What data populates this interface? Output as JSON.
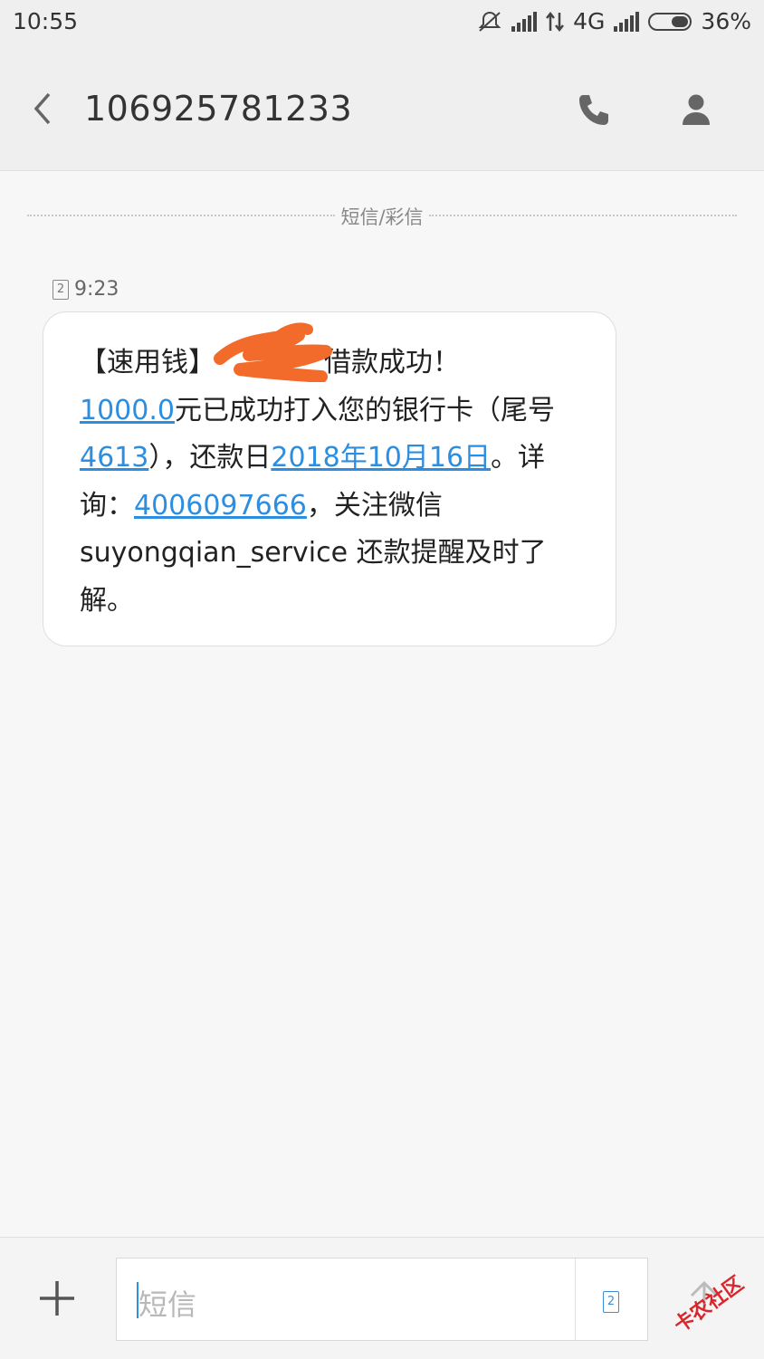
{
  "status_bar": {
    "time": "10:55",
    "network": "4G",
    "battery": "36%"
  },
  "header": {
    "title": "106925781233",
    "icons": [
      "back-icon",
      "phone-icon",
      "contact-icon"
    ]
  },
  "conversation": {
    "divider_label": "短信/彩信",
    "message": {
      "sim": "2",
      "time": "9:23",
      "segments": [
        {
          "text": "【速用钱】",
          "link": false
        },
        {
          "text": "借款成功！",
          "link": false
        },
        {
          "text": "1000.0",
          "link": true
        },
        {
          "text": "元已成功打入您的银行卡（尾号",
          "link": false
        },
        {
          "text": "4613",
          "link": true
        },
        {
          "text": "），还款日",
          "link": false
        },
        {
          "text": "2018年10月16日",
          "link": true
        },
        {
          "text": "。详询：",
          "link": false
        },
        {
          "text": "4006097666",
          "link": true
        },
        {
          "text": "，关注微信suyongqian_service 还款提醒及时了解。",
          "link": false
        }
      ]
    }
  },
  "composer": {
    "placeholder": "短信",
    "sim": "2"
  },
  "watermark": "卡农社区",
  "colors": {
    "link": "#2d8ee0",
    "redaction": "#f26b2a",
    "background": "#f7f7f7"
  }
}
